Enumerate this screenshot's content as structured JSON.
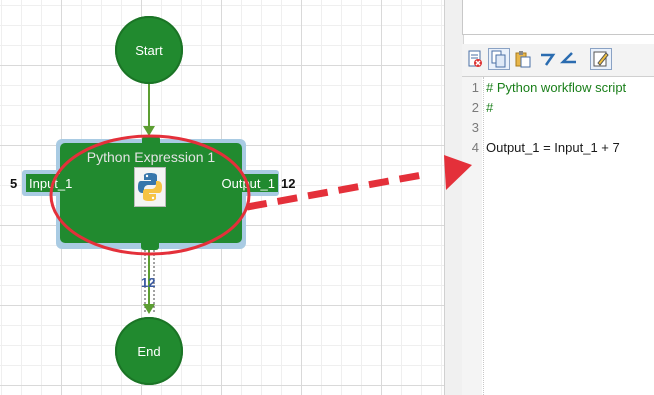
{
  "workflow": {
    "start_node": {
      "label": "Start"
    },
    "end_node": {
      "label": "End"
    },
    "python_node": {
      "title": "Python Expression 1",
      "input_port": {
        "label": "Input_1",
        "value": "5"
      },
      "output_port": {
        "label": "Output_1",
        "value": "12"
      }
    },
    "edge_value": "12",
    "colors": {
      "node_green": "#218a2f",
      "selection_blue": "#a9cbe3",
      "highlight_red": "#e4303a",
      "edge_green": "#5c9e32"
    }
  },
  "script_panel": {
    "toolbar_icons": [
      "clear-script-icon",
      "copy-icon",
      "paste-icon",
      "undo-icon",
      "redo-icon",
      "edit-icon"
    ],
    "lines": [
      {
        "number": "1",
        "text": "# Python workflow script",
        "kind": "comment"
      },
      {
        "number": "2",
        "text": "#",
        "kind": "comment"
      },
      {
        "number": "3",
        "text": "",
        "kind": "normal"
      },
      {
        "number": "4",
        "text": "Output_1 = Input_1 + 7",
        "kind": "normal"
      }
    ]
  }
}
